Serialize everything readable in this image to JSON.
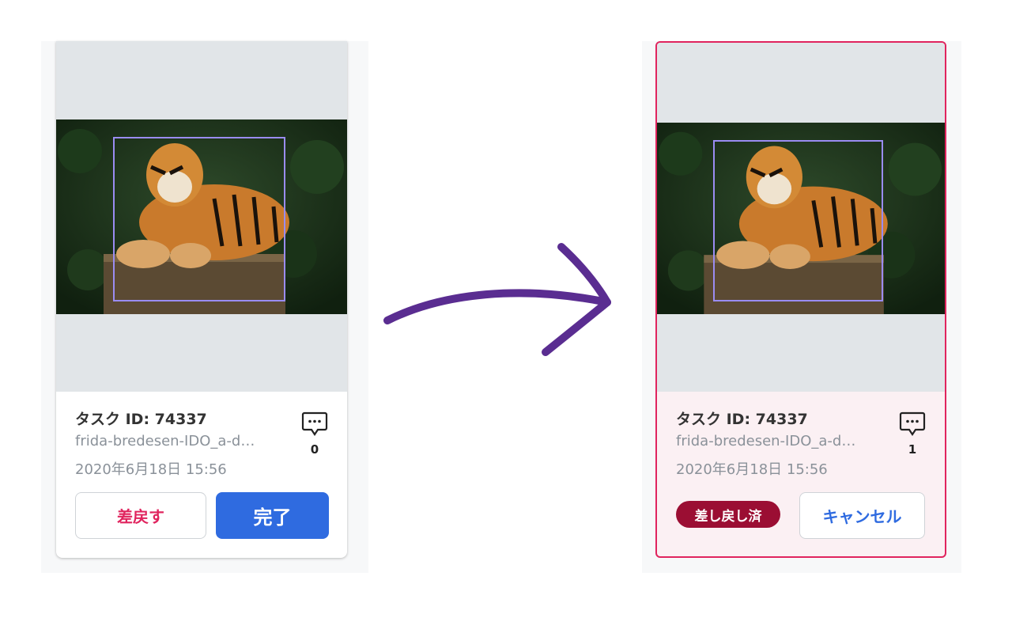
{
  "before_card": {
    "task_id": "タスク ID: 74337",
    "filename": "frida-bredesen-IDO_a-d…",
    "date": "2020年6月18日 15:56",
    "comment_count": "0",
    "reject_label": "差戻す",
    "done_label": "完了"
  },
  "after_card": {
    "task_id": "タスク ID: 74337",
    "filename": "frida-bredesen-IDO_a-d…",
    "date": "2020年6月18日 15:56",
    "comment_count": "1",
    "status_badge": "差し戻し済",
    "cancel_label": "キャンセル"
  },
  "colors": {
    "accent_blue": "#2f6be0",
    "reject_red": "#e0245e",
    "badge_dark_red": "#9b0e33",
    "arrow_purple": "#5a2d91",
    "bbox_lavender": "#9a8cf2"
  },
  "icons": [
    "comment-icon",
    "arrow-icon"
  ]
}
